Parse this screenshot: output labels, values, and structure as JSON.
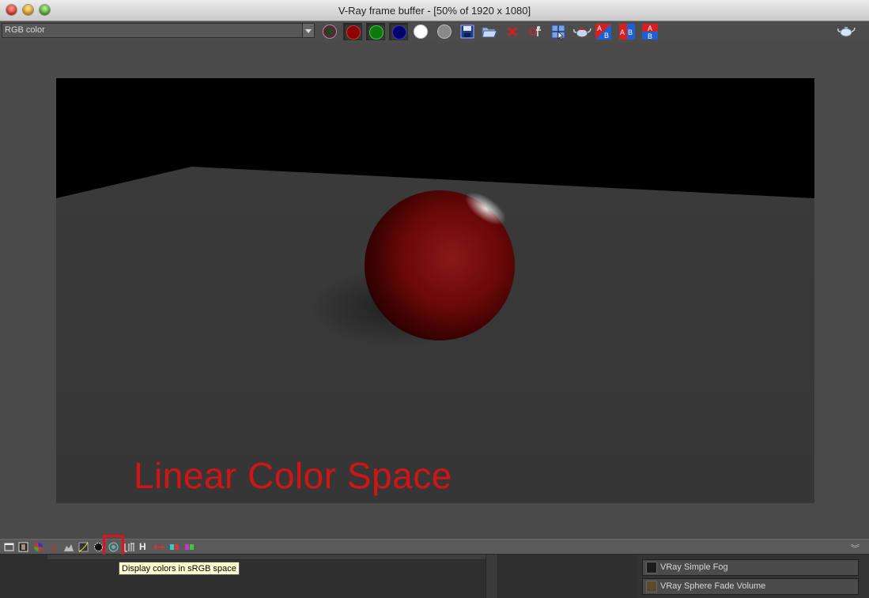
{
  "window": {
    "title": "V-Ray frame buffer - [50% of 1920 x 1080]"
  },
  "toolbar": {
    "channel_select": {
      "value": "RGB color"
    },
    "color_dots": [
      {
        "name": "red-channel-button",
        "color": "#8b0000",
        "pressed": true
      },
      {
        "name": "green-channel-button",
        "color": "#0b7a0b",
        "pressed": true
      },
      {
        "name": "blue-channel-button",
        "color": "#00006e",
        "pressed": true
      },
      {
        "name": "alpha-channel-button",
        "color": "#ffffff",
        "pressed": false
      },
      {
        "name": "mono-button",
        "color": "#8a8a8a",
        "pressed": false
      }
    ],
    "ab_labels": {
      "a": "A",
      "b": "B"
    }
  },
  "render": {
    "overlay_label": "Linear Color Space",
    "label_color": "#d01515",
    "sphere_color": "#7a0a0a"
  },
  "bottom_toolbar": {
    "history_label": "H",
    "tooltip": "Display colors in sRGB space"
  },
  "scene_list": {
    "items": [
      {
        "label": "VRay Simple Fog",
        "icon": "fog-icon"
      },
      {
        "label": "VRay Sphere Fade Volume",
        "icon": "sphere-fade-icon"
      }
    ]
  }
}
